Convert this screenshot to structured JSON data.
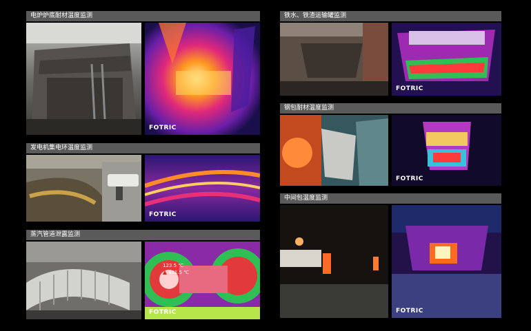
{
  "panels": [
    {
      "title": "电炉炉底耐材温度监测",
      "logo": "FOTRIC"
    },
    {
      "title": "发电机集电环温度监测",
      "logo": "FOTRIC"
    },
    {
      "title": "蒸汽管道泄露监测",
      "logo": "FOTRIC",
      "readouts": [
        "123.5 ℃",
        "421.5 ℃"
      ]
    },
    {
      "title": "铁水、铁渣运输罐监测",
      "logo": "FOTRIC"
    },
    {
      "title": "钢包耐材温度监测",
      "logo": "FOTRIC"
    },
    {
      "title": "中间包温度监测",
      "logo": "FOTRIC"
    }
  ],
  "colors": {
    "background": "#000000",
    "header": "#5a5a5a",
    "header_text": "#ffffff"
  }
}
